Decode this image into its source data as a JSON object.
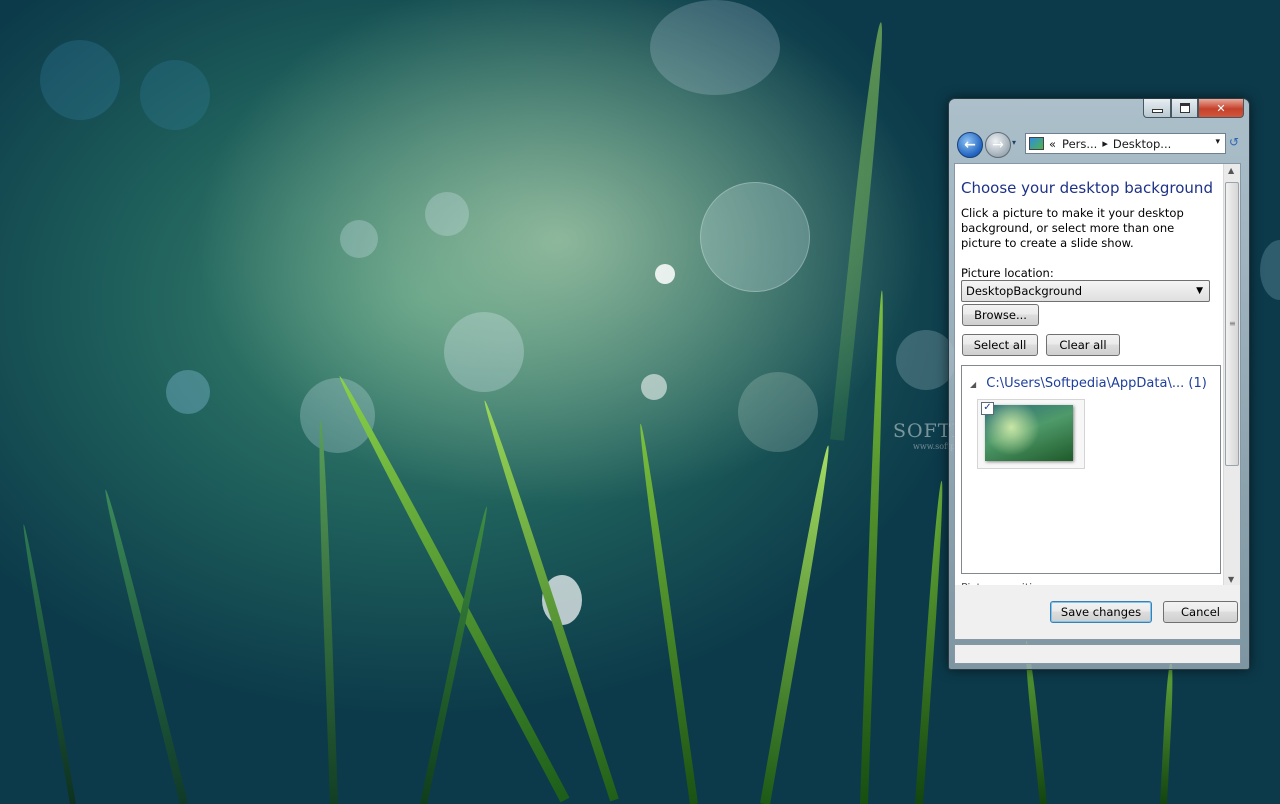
{
  "desktop": {
    "watermark": "SOFTPEDIA",
    "watermark_url": "www.softpedia.com"
  },
  "window": {
    "controls": {
      "minimize_icon": "minimize-icon",
      "maximize_icon": "maximize-icon",
      "close_icon": "close-icon",
      "close_glyph": "✕"
    },
    "navigation": {
      "back_glyph": "←",
      "forward_glyph": "→",
      "address_chevron": "«",
      "breadcrumb": [
        "Pers...",
        "Desktop..."
      ],
      "separator": "▸",
      "dropdown_glyph": "▾",
      "refresh_glyph": "↺"
    },
    "heading": "Choose your desktop background",
    "description": "Click a picture to make it your desktop background, or select more than one picture to create a slide show.",
    "picture_location_label": "Picture location:",
    "picture_location_value": "DesktopBackground",
    "browse_button": "Browse...",
    "select_all_button": "Select all",
    "clear_all_button": "Clear all",
    "gallery": {
      "group_triangle": "◢",
      "group_path": "C:\\Users\\Softpedia\\AppData\\...",
      "group_count": "(1)",
      "items": [
        {
          "checked": true,
          "check_glyph": "✓"
        }
      ]
    },
    "partial_label": "Picture position:",
    "save_button": "Save changes",
    "cancel_button": "Cancel"
  }
}
